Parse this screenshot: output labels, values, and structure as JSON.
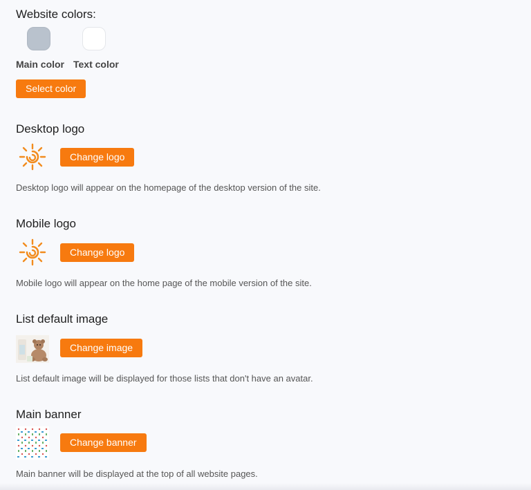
{
  "colors_section": {
    "title": "Website colors:",
    "main_color_label": "Main color",
    "text_color_label": "Text color",
    "select_color_button": "Select color",
    "main_color": "#b9c2cd",
    "text_color": "#ffffff",
    "accent": "#f77a0f"
  },
  "desktop_logo": {
    "title": "Desktop logo",
    "button": "Change logo",
    "description": "Desktop logo will appear on the homepage of the desktop version of the site.",
    "icon": "sun-logo-icon"
  },
  "mobile_logo": {
    "title": "Mobile logo",
    "button": "Change logo",
    "description": "Mobile logo will appear on the home page of the mobile version of the site.",
    "icon": "sun-logo-icon"
  },
  "list_default_image": {
    "title": "List default image",
    "button": "Change image",
    "description": "List default image will be displayed for those lists that don't have an avatar."
  },
  "main_banner": {
    "title": "Main banner",
    "button": "Change banner",
    "description": "Main banner will be displayed at the top of all website pages."
  }
}
